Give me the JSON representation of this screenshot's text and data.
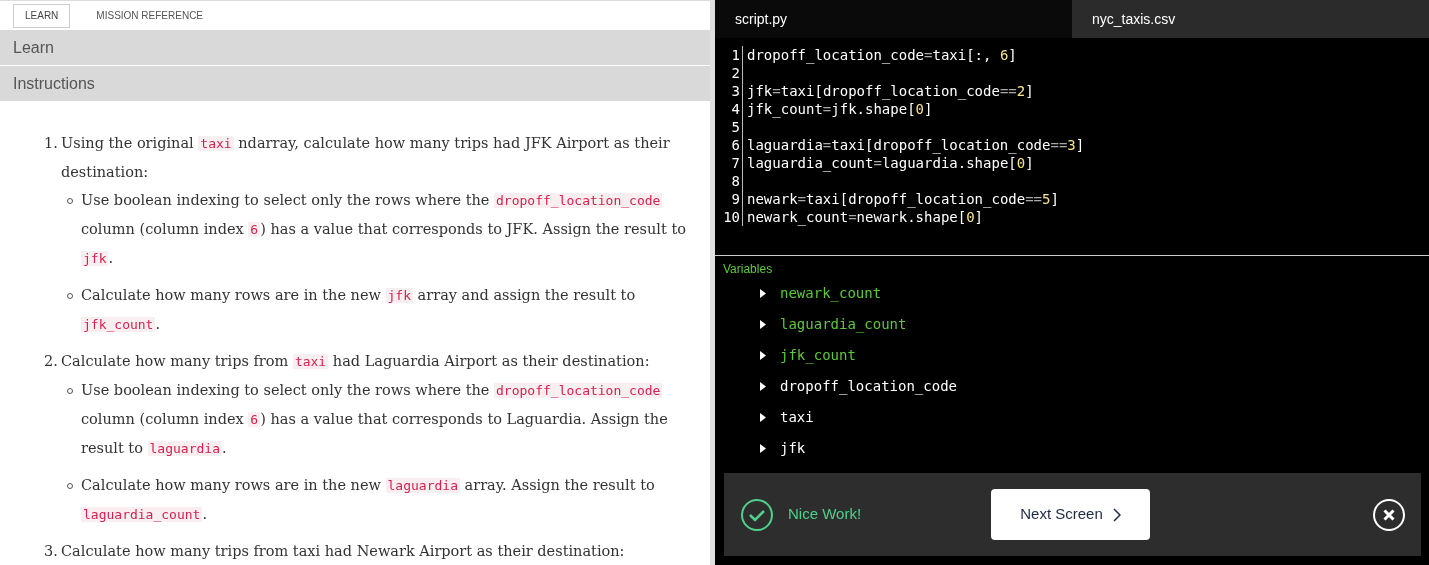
{
  "nav_tabs": [
    {
      "label": "LEARN",
      "selected": true
    },
    {
      "label": "MISSION REFERENCE",
      "selected": false
    }
  ],
  "sections": [
    "Learn",
    "Instructions"
  ],
  "instructions": [
    {
      "marker": "1.",
      "text": [
        {
          "t": "Using the original "
        },
        {
          "t": "taxi",
          "code": true
        },
        {
          "t": " ndarray, calculate how many trips had JFK Airport as their destination:"
        }
      ],
      "children": [
        {
          "text": [
            {
              "t": "Use boolean indexing to select only the rows where the "
            },
            {
              "t": "dropoff_location_code",
              "code": true
            },
            {
              "t": " column (column index "
            },
            {
              "t": "6",
              "code": true
            },
            {
              "t": ") has a value that corresponds to JFK. Assign the result to "
            },
            {
              "t": "jfk",
              "code": true
            },
            {
              "t": "."
            }
          ]
        },
        {
          "text": [
            {
              "t": "Calculate how many rows are in the new "
            },
            {
              "t": "jfk",
              "code": true
            },
            {
              "t": " array and assign the result to "
            },
            {
              "t": "jfk_count",
              "code": true
            },
            {
              "t": "."
            }
          ]
        }
      ]
    },
    {
      "marker": "2.",
      "text": [
        {
          "t": "Calculate how many trips from "
        },
        {
          "t": "taxi",
          "code": true
        },
        {
          "t": " had Laguardia Airport as their destination:"
        }
      ],
      "children": [
        {
          "text": [
            {
              "t": "Use boolean indexing to select only the rows where the "
            },
            {
              "t": "dropoff_location_code",
              "code": true
            },
            {
              "t": " column (column index "
            },
            {
              "t": "6",
              "code": true
            },
            {
              "t": ") has a value that corresponds to Laguardia. Assign the result to "
            },
            {
              "t": "laguardia",
              "code": true
            },
            {
              "t": "."
            }
          ]
        },
        {
          "text": [
            {
              "t": "Calculate how many rows are in the new "
            },
            {
              "t": "laguardia",
              "code": true
            },
            {
              "t": " array. Assign the result to "
            },
            {
              "t": "laguardia_count",
              "code": true
            },
            {
              "t": "."
            }
          ]
        }
      ]
    },
    {
      "marker": "3.",
      "text": [
        {
          "t": "Calculate how many trips from taxi had Newark Airport as their destination:"
        }
      ]
    }
  ],
  "editor_tabs": [
    {
      "label": "script.py",
      "selected": true
    },
    {
      "label": "nyc_taxis.csv",
      "selected": false
    }
  ],
  "code_lines": [
    {
      "number": "1",
      "code": "dropoff_location_code=taxi[:, 6]"
    },
    {
      "number": "2"
    },
    {
      "number": "3",
      "code": "jfk=taxi[dropoff_location_code==2]"
    },
    {
      "number": "4",
      "code": "jfk_count=jfk.shape[0]"
    },
    {
      "number": "5"
    },
    {
      "number": "6",
      "code": "laguardia=taxi[dropoff_location_code==3]"
    },
    {
      "number": "7",
      "code": "laguardia_count=laguardia.shape[0]"
    },
    {
      "number": "8"
    },
    {
      "number": "9",
      "code": "newark=taxi[dropoff_location_code==5]"
    },
    {
      "number": "10",
      "code": "newark_count=newark.shape[0]"
    }
  ],
  "variables": {
    "title": "Variables",
    "items": [
      {
        "name": "newark_count",
        "new": true
      },
      {
        "name": "laguardia_count",
        "new": true
      },
      {
        "name": "jfk_count",
        "new": true
      },
      {
        "name": "dropoff_location_code",
        "new": false
      },
      {
        "name": "taxi",
        "new": false
      },
      {
        "name": "jfk",
        "new": false
      }
    ]
  },
  "toast": {
    "message": "Nice Work!",
    "button": "Next Screen"
  }
}
